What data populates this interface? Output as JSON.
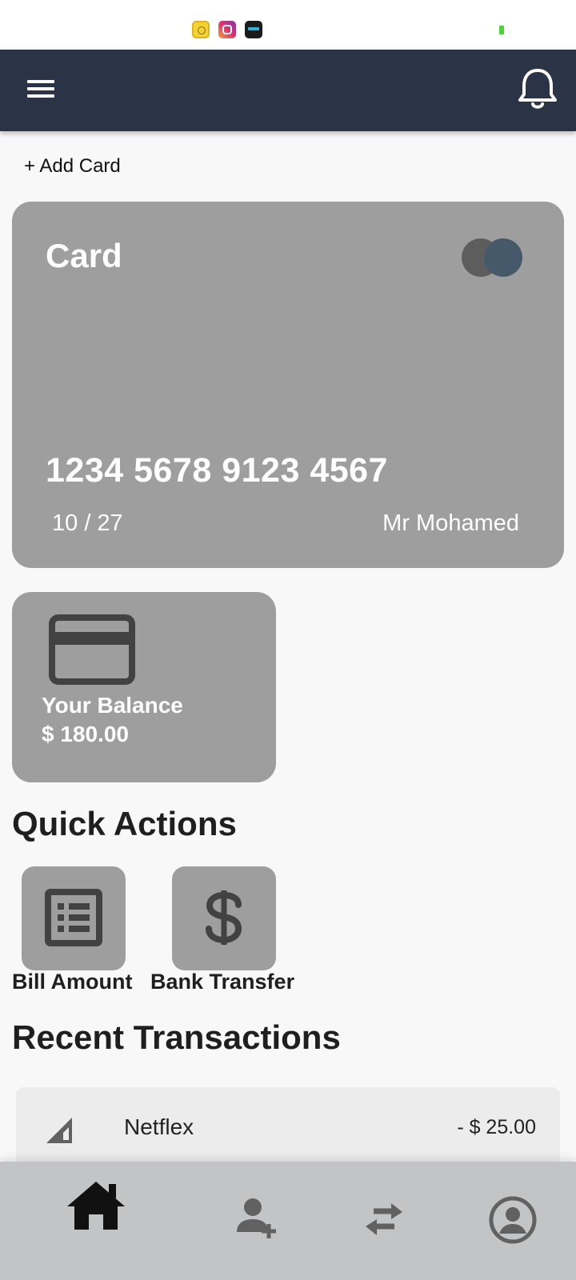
{
  "status_bar": {
    "icons": [
      "app-icon-yellow",
      "instagram-icon",
      "app-icon-365"
    ],
    "battery_color": "#4cd137"
  },
  "app_bar": {
    "background": "#2b3447",
    "menu_icon": "menu-icon",
    "notification_icon": "bell-icon"
  },
  "add_card": {
    "label": "+ Add Card"
  },
  "card": {
    "title": "Card",
    "number": "1234 5678 9123 4567",
    "expiry": "10 / 27",
    "holder": "Mr Mohamed",
    "brand_icon": "card-brand-circles-icon",
    "background": "#9e9e9e"
  },
  "balance": {
    "icon": "credit-card-icon",
    "label": "Your Balance",
    "value": "$ 180.00"
  },
  "quick_actions": {
    "title": "Quick Actions",
    "items": [
      {
        "label": "Bill Amount",
        "icon": "list-icon"
      },
      {
        "label": "Bank Transfer",
        "icon": "dollar-icon"
      }
    ]
  },
  "recent_transactions": {
    "title": "Recent Transactions",
    "items": [
      {
        "name": "Netflex",
        "amount": "- $ 25.00",
        "icon": "signal-icon"
      }
    ]
  },
  "bottom_nav": {
    "items": [
      {
        "icon": "home-icon",
        "active": true
      },
      {
        "icon": "add-user-icon",
        "active": false
      },
      {
        "icon": "transfer-arrows-icon",
        "active": false
      },
      {
        "icon": "profile-icon",
        "active": false
      }
    ]
  }
}
